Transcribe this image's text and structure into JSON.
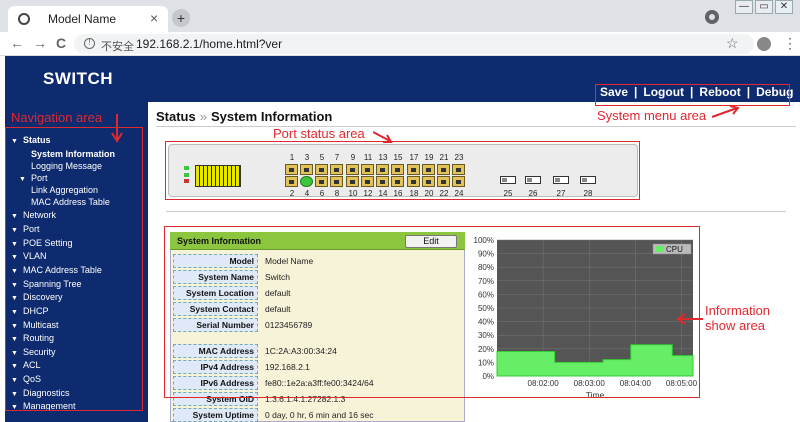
{
  "browser": {
    "tab_title": "Model Name",
    "tab_close": "×",
    "new_tab": "+",
    "insecure_label": "不安全",
    "url": "192.168.2.1/home.html?ver",
    "back": "←",
    "forward": "→",
    "reload": "C",
    "star": "☆",
    "menu": "⋮",
    "win_min": "—",
    "win_max": "▭",
    "win_close": "✕"
  },
  "app": {
    "logo": "SWITCH",
    "system_menu": [
      "Save",
      "Logout",
      "Reboot",
      "Debug"
    ],
    "separator": "|"
  },
  "breadcrumb": {
    "section": "Status",
    "chevron": "»",
    "page": "System Information"
  },
  "sidebar": {
    "items": [
      {
        "label": "Status",
        "expanded": true,
        "bold": true
      },
      {
        "label": "System Information",
        "sub": true,
        "active": true
      },
      {
        "label": "Logging Message",
        "sub": true
      },
      {
        "label": "Port",
        "sub_parent": true,
        "expanded": true
      },
      {
        "label": "Link Aggregation",
        "sub": true
      },
      {
        "label": "MAC Address Table",
        "sub": true
      },
      {
        "label": "Network"
      },
      {
        "label": "Port"
      },
      {
        "label": "POE Setting"
      },
      {
        "label": "VLAN"
      },
      {
        "label": "MAC Address Table"
      },
      {
        "label": "Spanning Tree"
      },
      {
        "label": "Discovery"
      },
      {
        "label": "DHCP"
      },
      {
        "label": "Multicast"
      },
      {
        "label": "Routing"
      },
      {
        "label": "Security"
      },
      {
        "label": "ACL"
      },
      {
        "label": "QoS"
      },
      {
        "label": "Diagnostics"
      },
      {
        "label": "Management"
      }
    ]
  },
  "ports": {
    "top_numbers": [
      "1",
      "3",
      "5",
      "7",
      "9",
      "11",
      "13",
      "15",
      "17",
      "19",
      "21",
      "23"
    ],
    "bottom_numbers": [
      "2",
      "4",
      "6",
      "8",
      "10",
      "12",
      "14",
      "16",
      "18",
      "20",
      "22",
      "24"
    ],
    "sfp_numbers": [
      "25",
      "26",
      "27",
      "28"
    ],
    "link_up": [
      "4"
    ]
  },
  "system_info": {
    "title": "System Information",
    "edit_label": "Edit",
    "rows": [
      {
        "label": "Model",
        "value": "Model Name"
      },
      {
        "label": "System Name",
        "value": "Switch"
      },
      {
        "label": "System Location",
        "value": "default"
      },
      {
        "label": "System Contact",
        "value": "default"
      },
      {
        "label": "Serial Number",
        "value": "0123456789"
      },
      {
        "label": "MAC Address",
        "value": "1C:2A:A3:00:34:24"
      },
      {
        "label": "IPv4 Address",
        "value": "192.168.2.1"
      },
      {
        "label": "IPv6 Address",
        "value": "fe80::1e2a:a3ff:fe00:3424/64"
      },
      {
        "label": "System OID",
        "value": "1.3.6.1.4.1.27282.1.3"
      },
      {
        "label": "System Uptime",
        "value": "0 day, 0 hr, 6 min and 16 sec"
      }
    ]
  },
  "chart_data": {
    "type": "area",
    "legend": [
      "CPU"
    ],
    "legend_position": "top-right",
    "xlabel": "Time",
    "x_ticks": [
      "08:02:00",
      "08:03:00",
      "08:04:00",
      "08:05:00"
    ],
    "y_ticks": [
      "0%",
      "10%",
      "20%",
      "30%",
      "40%",
      "50%",
      "60%",
      "70%",
      "80%",
      "90%",
      "100%"
    ],
    "ylim": [
      0,
      100
    ],
    "xlim_minutes": [
      0,
      4.25
    ],
    "series": [
      {
        "name": "CPU",
        "x_minutes": [
          0,
          1.25,
          1.25,
          2.3,
          2.3,
          2.9,
          2.9,
          3.8,
          3.8,
          4.25
        ],
        "values": [
          18,
          18,
          10,
          10,
          12,
          12,
          23,
          23,
          15,
          15
        ]
      }
    ],
    "colors": {
      "background": "#555555",
      "fill": "#66ee66",
      "line": "#33cc33",
      "legend": "#66ee66"
    }
  },
  "annotations": {
    "navigation": "Navigation area",
    "port_status": "Port status area",
    "system_menu": "System menu area",
    "information": [
      "Information",
      "show area"
    ],
    "color": "#e0282f"
  }
}
